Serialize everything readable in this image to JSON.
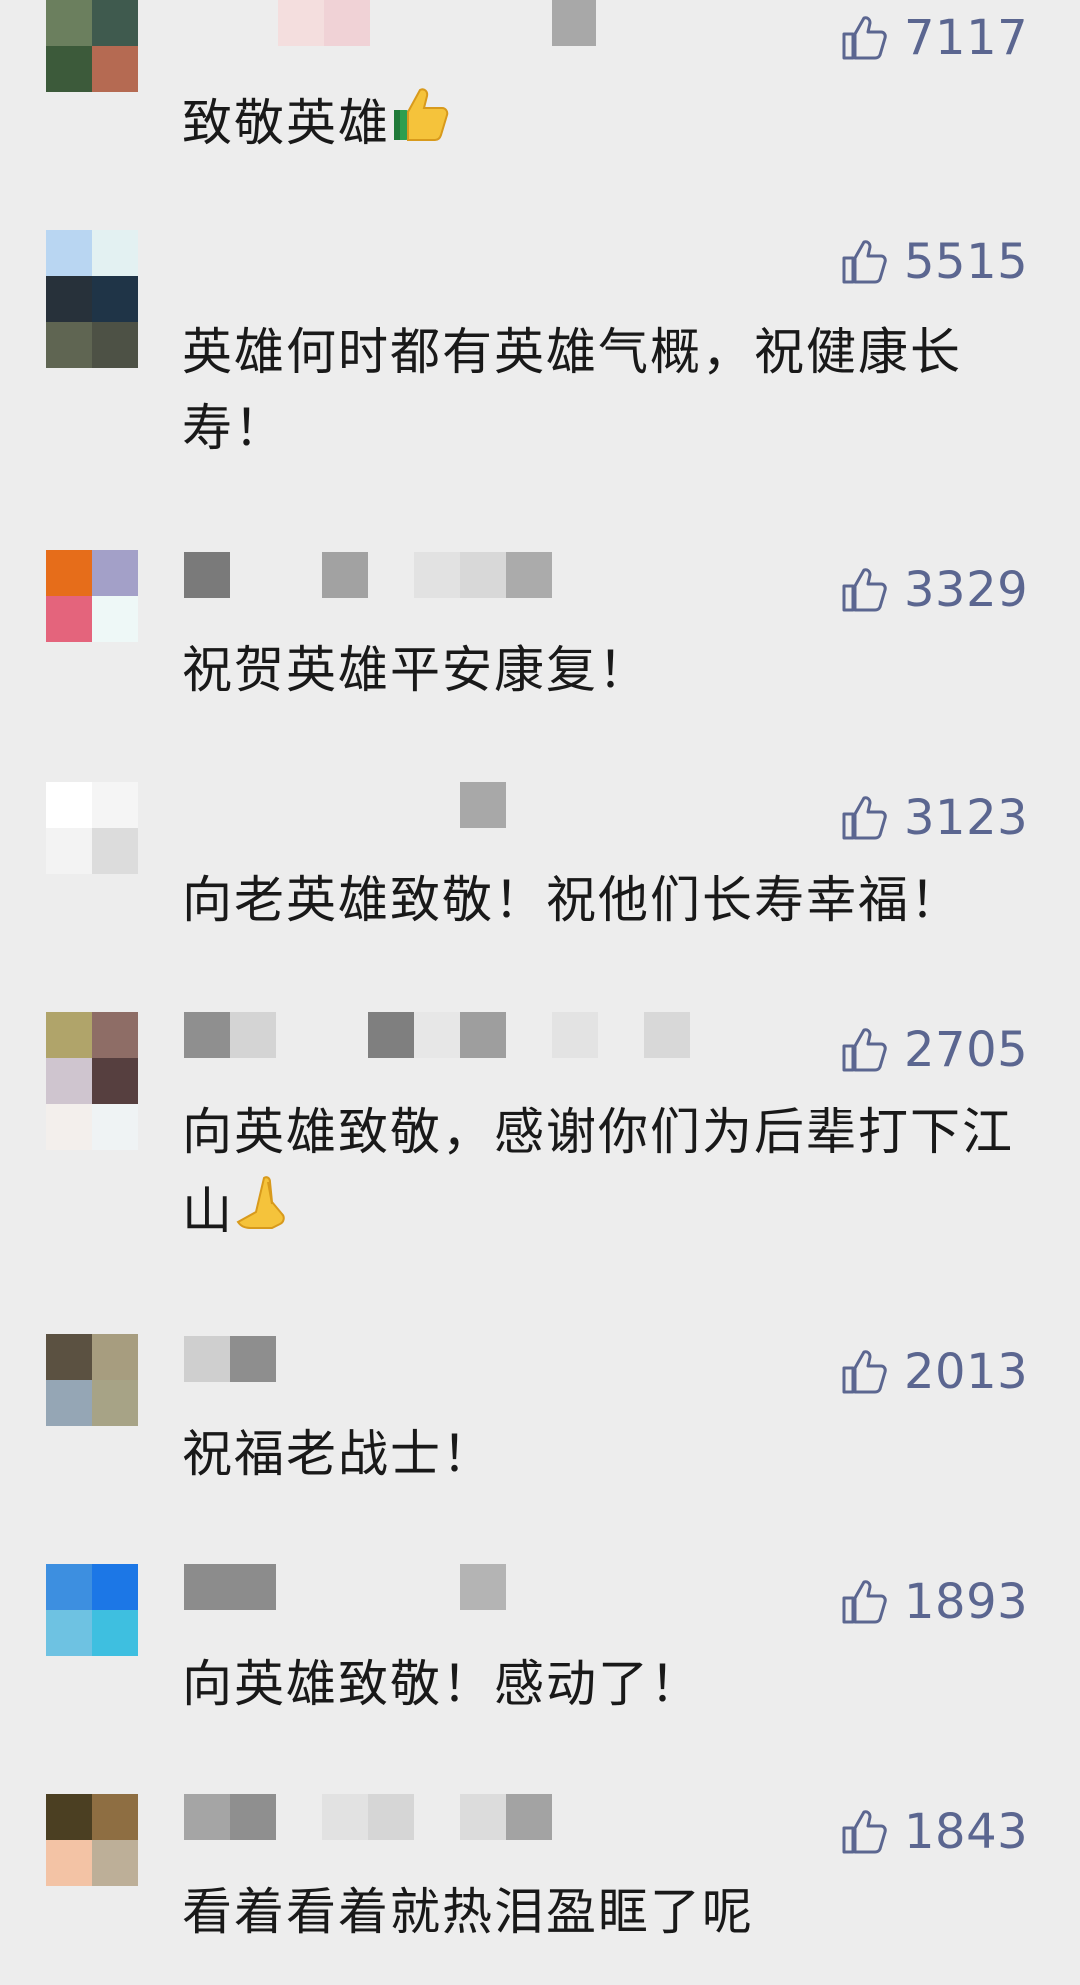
{
  "comments": [
    {
      "likes": "7117",
      "text": "致敬英雄",
      "emoji": "thumbs-up-emoji",
      "avatar_colors": [
        "#6b7f5e",
        "#3f5a4e",
        "#3c5a3a",
        "#b56a52"
      ],
      "name_blur_colors": [
        "#f4dede",
        "#f0d2d6",
        "#a8a8a8"
      ]
    },
    {
      "likes": "5515",
      "text": "英雄何时都有英雄气概，祝健康长寿！",
      "avatar_colors": [
        "#b9d6f2",
        "#e3f1f2",
        "#27313a",
        "#1f3447",
        "#5f6552",
        "#4d5145"
      ],
      "name_blur_colors": []
    },
    {
      "likes": "3329",
      "text": "祝贺英雄平安康复！",
      "avatar_colors": [
        "#e66d1a",
        "#a3a0c8",
        "#e4647c",
        "#eef8f7"
      ],
      "name_blur_colors": [
        "#7a7a7a",
        "#a2a2a2",
        "#e2e2e2",
        "#d8d8d8",
        "#ababab"
      ]
    },
    {
      "likes": "3123",
      "text": "向老英雄致敬！祝他们长寿幸福！",
      "avatar_colors": [
        "#ffffff",
        "#f5f5f5",
        "#f3f3f3",
        "#dcdcdc"
      ],
      "name_blur_colors": [
        "#a8a8a8"
      ]
    },
    {
      "likes": "2705",
      "text": "向英雄致敬，感谢你们为后辈打下江山",
      "emoji": "folded-hands-emoji",
      "avatar_colors": [
        "#b0a46a",
        "#8e6d66",
        "#cfc5cf",
        "#563f3f",
        "#f3efec",
        "#eff3f4"
      ],
      "name_blur_colors": [
        "#8f8f8f",
        "#d4d4d4",
        "#7f7f7f",
        "#e7e7e7",
        "#9e9e9e",
        "#e3e3e3",
        "#d8d8d8"
      ]
    },
    {
      "likes": "2013",
      "text": "祝福老战士！",
      "avatar_colors": [
        "#5b5141",
        "#a79d7f",
        "#95a6b5",
        "#a7a386"
      ],
      "name_blur_colors": [
        "#cfcfcf",
        "#8e8e8e"
      ]
    },
    {
      "likes": "1893",
      "text": "向英雄致敬！感动了！",
      "avatar_colors": [
        "#3d8fe0",
        "#1c77e6",
        "#6ec2e2",
        "#3ebfe0"
      ],
      "name_blur_colors": [
        "#8c8c8c",
        "#8c8c8c",
        "#b4b4b4"
      ]
    },
    {
      "likes": "1843",
      "text": "看着看着就热泪盈眶了呢",
      "avatar_colors": [
        "#4b3f22",
        "#8e6e42",
        "#f3c3a5",
        "#bdaf98"
      ],
      "name_blur_colors": [
        "#a5a5a5",
        "#8f8f8f",
        "#e2e2e2",
        "#d6d6d6",
        "#dcdcdc",
        "#a3a3a3"
      ]
    }
  ]
}
